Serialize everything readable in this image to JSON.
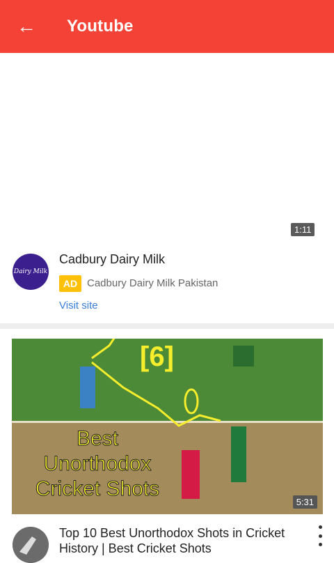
{
  "appbar": {
    "title": "Youtube",
    "back_icon": "arrow-left-icon"
  },
  "ad_video": {
    "duration": "1:11"
  },
  "ad": {
    "title": "Cadbury Dairy Milk",
    "badge": "AD",
    "channel": "Cadbury Dairy Milk Pakistan",
    "visit_label": "Visit site",
    "avatar_text": "Dairy Milk"
  },
  "video": {
    "thumb_overlay_number": "[6]",
    "thumb_overlay_text": "Best Unorthodox Cricket Shots",
    "duration": "5:31",
    "title": "Top 10 Best Unorthodox Shots in Cricket History | Best Cricket Shots",
    "menu_icon": "more-vert-icon"
  },
  "colors": {
    "appbar": "#f44336",
    "ad_badge": "#ffc107",
    "link": "#3b7dd8"
  }
}
